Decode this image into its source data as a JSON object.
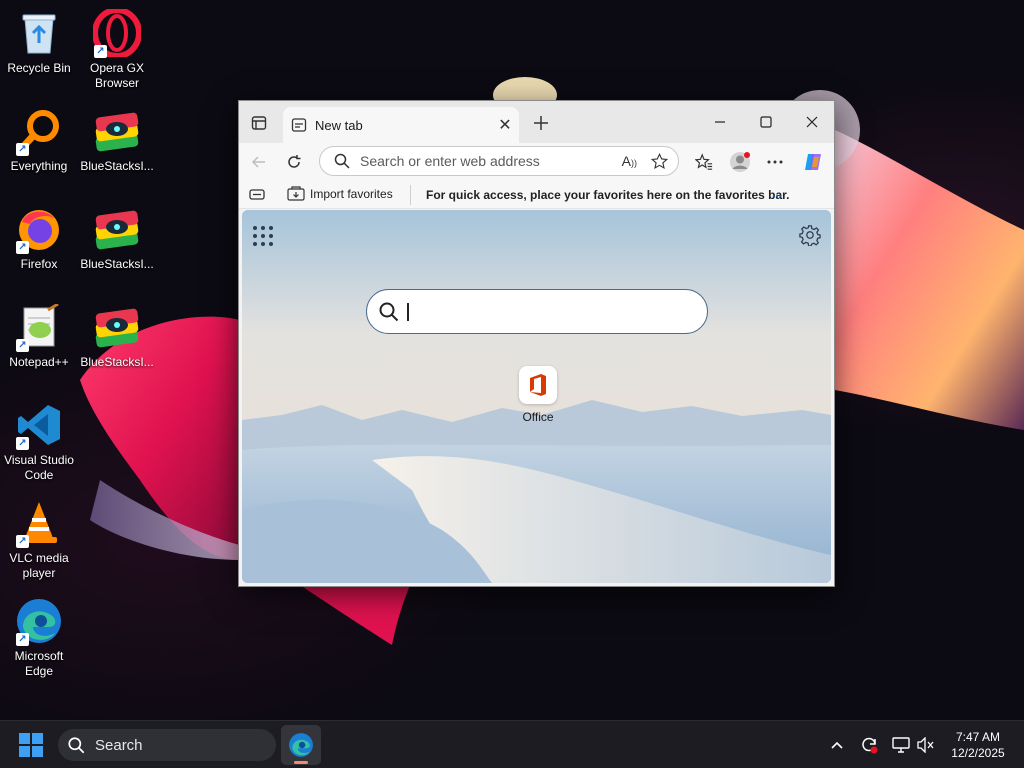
{
  "desktop": {
    "icons": [
      {
        "label": "Recycle Bin",
        "icon": "recycle-bin-icon"
      },
      {
        "label": "Opera GX Browser",
        "icon": "opera-gx-icon"
      },
      {
        "label": "Everything",
        "icon": "everything-search-icon"
      },
      {
        "label": "BlueStacksI...",
        "icon": "bluestacks-icon"
      },
      {
        "label": "Firefox",
        "icon": "firefox-icon"
      },
      {
        "label": "BlueStacksI...",
        "icon": "bluestacks-icon"
      },
      {
        "label": "Notepad++",
        "icon": "notepadpp-icon"
      },
      {
        "label": "BlueStacksI...",
        "icon": "bluestacks-icon"
      },
      {
        "label": "Visual Studio Code",
        "icon": "vscode-icon"
      },
      {
        "label": "VLC media player",
        "icon": "vlc-icon"
      },
      {
        "label": "Microsoft Edge",
        "icon": "edge-icon"
      }
    ]
  },
  "browser": {
    "tab": {
      "title": "New tab"
    },
    "address": {
      "placeholder": "Search or enter web address"
    },
    "favorites_bar": {
      "import_label": "Import favorites",
      "hint": "For quick access, place your favorites here on the favorites bar.",
      "more_label": "..."
    },
    "newtab": {
      "search_value": "",
      "quicklink": {
        "label": "Office"
      }
    },
    "colors": {
      "accent": "#4a6c8c",
      "office_red": "#d83b01"
    }
  },
  "taskbar": {
    "search_placeholder": "Search",
    "clock": {
      "time": "7:47 AM",
      "date": "12/2/2025"
    }
  }
}
